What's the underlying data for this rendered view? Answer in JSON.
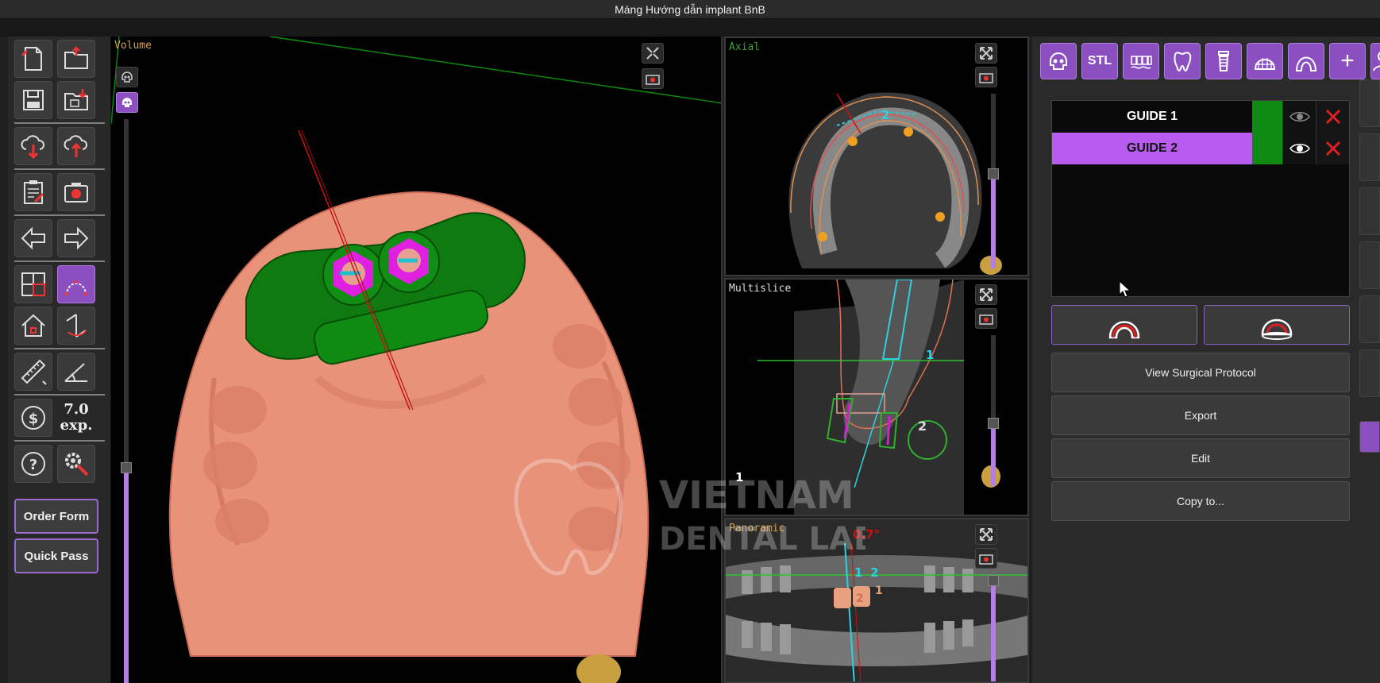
{
  "window": {
    "title": "Máng Hướng dẫn implant BnB"
  },
  "left_toolbar": {
    "price_value": "7.0",
    "price_unit": "exp.",
    "order_form_label": "Order Form",
    "quick_pass_label": "Quick Pass"
  },
  "viewports": {
    "volume_label": "Volume",
    "axial_label": "Axial",
    "multislice_label": "Multislice",
    "panoramic_label": "Panoramic"
  },
  "overlays": {
    "axial_implant_number": "2",
    "multislice_number_1": "1",
    "multislice_number_2": "2",
    "multislice_bottom_number": "1",
    "panoramic_angle": "0.7°",
    "panoramic_number_1": "1",
    "panoramic_number_2": "2",
    "panoramic_tooth_1": "1",
    "panoramic_tooth_2": "2",
    "watermark_line_1": "VIETNAM",
    "watermark_line_2": "DENTAL LAB"
  },
  "right_panel": {
    "top_icons": [
      "skull-icon",
      "stl-icon",
      "teeth-row-icon",
      "tooth-icon",
      "implant-icon",
      "arch-grid-icon",
      "guide-arch-icon",
      "plus-icon",
      "user-icon"
    ],
    "stl_label": "STL",
    "plus_label": "+",
    "guides": [
      {
        "name": "GUIDE 1",
        "color": "#0f8a12",
        "selected": false
      },
      {
        "name": "GUIDE 2",
        "color": "#0f8a12",
        "selected": true
      }
    ],
    "buttons": {
      "view_surgical_protocol": "View Surgical Protocol",
      "export": "Export",
      "edit": "Edit",
      "copy_to": "Copy to..."
    }
  },
  "colors": {
    "accent": "#8b4fc0",
    "selected_row": "#b85cf0",
    "guide_green": "#0f8a12",
    "model_salmon": "#e8927a",
    "delete_red": "#e02020"
  }
}
